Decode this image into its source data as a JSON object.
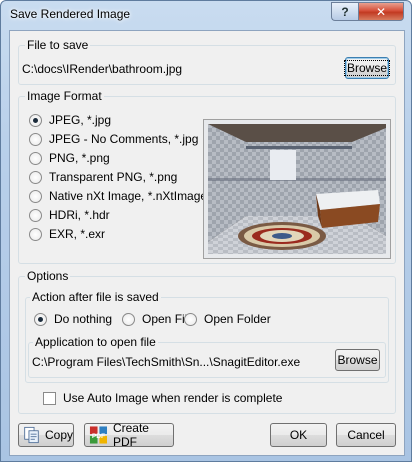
{
  "window": {
    "title": "Save Rendered Image",
    "help_glyph": "?",
    "close_glyph": "✕"
  },
  "file_to_save": {
    "legend": "File to save",
    "path": "C:\\docs\\IRender\\bathroom.jpg",
    "browse_label": "Browse"
  },
  "image_format": {
    "legend": "Image Format",
    "options": [
      {
        "label": "JPEG, *.jpg",
        "selected": true
      },
      {
        "label": "JPEG - No Comments, *.jpg",
        "selected": false
      },
      {
        "label": "PNG, *.png",
        "selected": false
      },
      {
        "label": "Transparent PNG, *.png",
        "selected": false
      },
      {
        "label": "Native nXt Image, *.nXtImage",
        "selected": false
      },
      {
        "label": "HDRi, *.hdr",
        "selected": false
      },
      {
        "label": "EXR, *.exr",
        "selected": false
      }
    ]
  },
  "options": {
    "legend": "Options",
    "action": {
      "legend": "Action after file is saved",
      "choices": [
        {
          "label": "Do nothing",
          "selected": true
        },
        {
          "label": "Open File",
          "selected": false
        },
        {
          "label": "Open Folder",
          "selected": false
        }
      ]
    },
    "app": {
      "legend": "Application to open file",
      "path": "C:\\Program Files\\TechSmith\\Sn...\\SnagitEditor.exe",
      "browse_label": "Browse"
    },
    "auto_image_label": "Use Auto Image when render is complete"
  },
  "footer": {
    "copy_label": "Copy",
    "create_pdf_label": "Create PDF",
    "ok_label": "OK",
    "cancel_label": "Cancel"
  }
}
